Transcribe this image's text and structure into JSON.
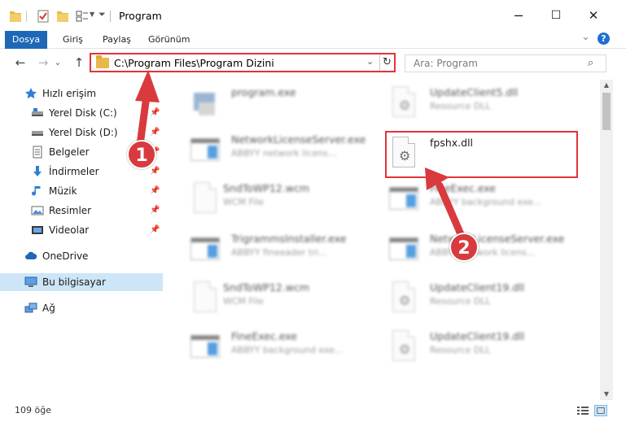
{
  "window": {
    "title": "Program",
    "minimize_label": "─",
    "maximize_label": "☐",
    "close_label": "✕"
  },
  "ribbon": {
    "tabs": [
      "Dosya",
      "Giriş",
      "Paylaş",
      "Görünüm"
    ],
    "expand_glyph": "⌄",
    "help_glyph": "?"
  },
  "nav": {
    "back_glyph": "←",
    "forward_glyph": "→",
    "recent_glyph": "⌄",
    "up_glyph": "↑",
    "address": "C:\\Program Files\\Program Dizini",
    "dropdown_glyph": "⌄",
    "refresh_glyph": "↻",
    "search_placeholder": "Ara: Program",
    "search_glyph": "⌕"
  },
  "sidebar": {
    "items": [
      {
        "label": "Hızlı erişim",
        "icon": "star-icon"
      },
      {
        "label": "Yerel Disk (C:)",
        "icon": "drive-icon",
        "pinned": true
      },
      {
        "label": "Yerel Disk (D:)",
        "icon": "drive-icon",
        "pinned": true
      },
      {
        "label": "Belgeler",
        "icon": "documents-icon",
        "pinned": true
      },
      {
        "label": "İndirmeler",
        "icon": "download-icon",
        "pinned": true
      },
      {
        "label": "Müzik",
        "icon": "music-icon",
        "pinned": true
      },
      {
        "label": "Resimler",
        "icon": "pictures-icon",
        "pinned": true
      },
      {
        "label": "Videolar",
        "icon": "videos-icon",
        "pinned": true
      },
      {
        "label": "OneDrive",
        "icon": "cloud-icon"
      },
      {
        "label": "Bu bilgisayar",
        "icon": "computer-icon",
        "selected": true
      },
      {
        "label": "Ağ",
        "icon": "network-icon"
      }
    ],
    "pin_glyph": "📌"
  },
  "files": [
    {
      "name": "program.exe",
      "desc": "",
      "type": "installer"
    },
    {
      "name": "UpdateClient5.dll",
      "desc": "Resource DLL",
      "type": "dll"
    },
    {
      "name": "NetworkLicenseServer.exe",
      "desc": "ABBYY network licens...",
      "type": "app"
    },
    {
      "name": "fpshx.dll",
      "desc": "",
      "type": "dll",
      "highlighted": true
    },
    {
      "name": "SndToWP12.wcm",
      "desc": "WCM File",
      "type": "doc"
    },
    {
      "name": "FineExec.exe",
      "desc": "ABBYY background exe...",
      "type": "app"
    },
    {
      "name": "TrigrammsInstaller.exe",
      "desc": "ABBYY fineeader tri...",
      "type": "app"
    },
    {
      "name": "NetworkLicenseServer.exe",
      "desc": "ABBYY network licens...",
      "type": "app"
    },
    {
      "name": "SndToWP12.wcm",
      "desc": "WCM File",
      "type": "doc"
    },
    {
      "name": "UpdateClient19.dll",
      "desc": "Resource DLL",
      "type": "dll"
    },
    {
      "name": "FineExec.exe",
      "desc": "ABBYY background exe...",
      "type": "app"
    },
    {
      "name": "UpdateClient19.dll",
      "desc": "Resource DLL",
      "type": "dll"
    }
  ],
  "callouts": {
    "first": "1",
    "second": "2"
  },
  "scrollbar": {
    "up_glyph": "▲",
    "down_glyph": "▼"
  },
  "status": {
    "item_count": "109 öğe"
  },
  "colors": {
    "accent": "#1e67b6",
    "annotation": "#e0343a",
    "selection": "#cde6f7"
  }
}
